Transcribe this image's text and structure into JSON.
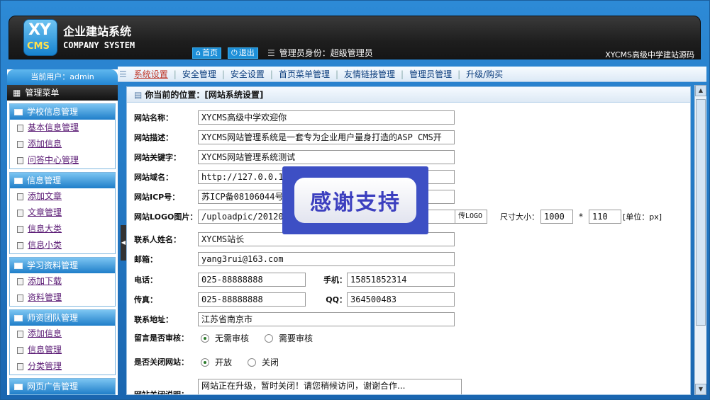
{
  "header": {
    "logo_xy": "XY",
    "logo_cms": "CMS",
    "brand_cn": "企业建站系统",
    "brand_en": "COMPANY SYSTEM",
    "home_label": "首页",
    "logout_label": "退出",
    "admin_identity": "管理员身份：超级管理员",
    "right_title": "XYCMS高级中学建站源码"
  },
  "sidebar": {
    "current_user": "当前用户：admin",
    "menu_title": "管理菜单",
    "groups": [
      {
        "title": "学校信息管理",
        "items": [
          "基本信息管理",
          "添加信息",
          "问答中心管理"
        ]
      },
      {
        "title": "信息管理",
        "items": [
          "添加文章",
          "文章管理",
          "信息大类",
          "信息小类"
        ]
      },
      {
        "title": "学习资料管理",
        "items": [
          "添加下载",
          "资料管理"
        ]
      },
      {
        "title": "师资团队管理",
        "items": [
          "添加信息",
          "信息管理",
          "分类管理"
        ]
      },
      {
        "title": "网页广告管理",
        "items": []
      }
    ]
  },
  "topnav": [
    "系统设置",
    "安全管理",
    "安全设置",
    "首页菜单管理",
    "友情链接管理",
    "管理员管理",
    "升级/购买"
  ],
  "position": "你当前的位置：[网站系统设置]",
  "form": {
    "site_name": {
      "label": "网站名称：",
      "value": "XYCMS高级中学欢迎你"
    },
    "site_desc": {
      "label": "网站描述：",
      "value": "XYCMS网站管理系统是一套专为企业用户量身打造的ASP CMS开"
    },
    "site_keywords": {
      "label": "网站关键字：",
      "value": "XYCMS网站管理系统测试"
    },
    "site_domain": {
      "label": "网站域名：",
      "value": "http://127.0.0.1"
    },
    "site_icp": {
      "label": "网站ICP号：",
      "value": "苏ICP备08106044号"
    },
    "site_logo": {
      "label": "网站LOGO图片：",
      "value": "/uploadpic/20120",
      "upload_btn": "传LOGO",
      "size_label": "尺寸大小：",
      "width": "1000",
      "times": "*",
      "height": "110",
      "unit": "[单位：px]"
    },
    "contact_name": {
      "label": "联系人姓名：",
      "value": "XYCMS站长"
    },
    "email": {
      "label": "邮箱：",
      "value": "yang3rui@163.com"
    },
    "phone": {
      "label": "电话：",
      "value": "025-88888888"
    },
    "mobile": {
      "label": "手机：",
      "value": "15851852314"
    },
    "fax": {
      "label": "传真：",
      "value": "025-88888888"
    },
    "qq": {
      "label": "QQ：",
      "value": "364500483"
    },
    "address": {
      "label": "联系地址：",
      "value": "江苏省南京市"
    },
    "review": {
      "label": "留言是否审核：",
      "options": [
        "无需审核",
        "需要审核"
      ],
      "selected": "无需审核"
    },
    "close_site": {
      "label": "是否关闭网站：",
      "options": [
        "开放",
        "关闭"
      ],
      "selected": "开放"
    },
    "close_msg": {
      "label": "网站关闭说明：",
      "value": "网站正在升级，暂时关闭！请您稍候访问，谢谢合作..."
    }
  },
  "overlay_text": "感谢支持"
}
